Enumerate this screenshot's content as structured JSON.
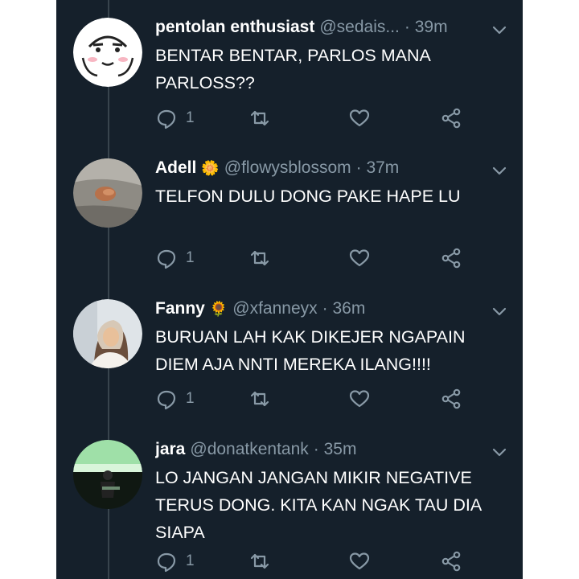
{
  "tweets": [
    {
      "display_name": "pentolan enthusiast",
      "badge": "",
      "handle": "@sedais...",
      "time": "· 39m",
      "text": "BENTAR BENTAR,  PARLOS MANA PARLOSS??",
      "reply_count": "1",
      "avatar": "emoji-face-avatar"
    },
    {
      "display_name": "Adell",
      "badge": "🌼",
      "handle": "@flowysblossom",
      "time": "· 37m",
      "text": "TELFON DULU DONG PAKE HAPE LU",
      "reply_count": "1",
      "avatar": "photo-avatar"
    },
    {
      "display_name": "Fanny",
      "badge": "🌻",
      "handle": "@xfanneyx",
      "time": "· 36m",
      "text": "BURUAN LAH KAK DIKEJER NGAPAIN DIEM AJA NNTI MEREKA ILANG!!!!",
      "reply_count": "1",
      "avatar": "photo-avatar"
    },
    {
      "display_name": "jara",
      "badge": "",
      "handle": "@donatkentank",
      "time": "· 35m",
      "text": "LO JANGAN JANGAN MIKIR NEGATIVE TERUS DONG. KITA KAN NGAK TAU DIA SIAPA",
      "reply_count": "1",
      "avatar": "photo-avatar"
    }
  ],
  "colors": {
    "background": "#15202b",
    "text_primary": "#ffffff",
    "text_secondary": "#8899a6",
    "thread_line": "#38444d"
  },
  "icons": [
    "reply-icon",
    "retweet-icon",
    "like-icon",
    "share-icon",
    "chevron-down-icon"
  ]
}
